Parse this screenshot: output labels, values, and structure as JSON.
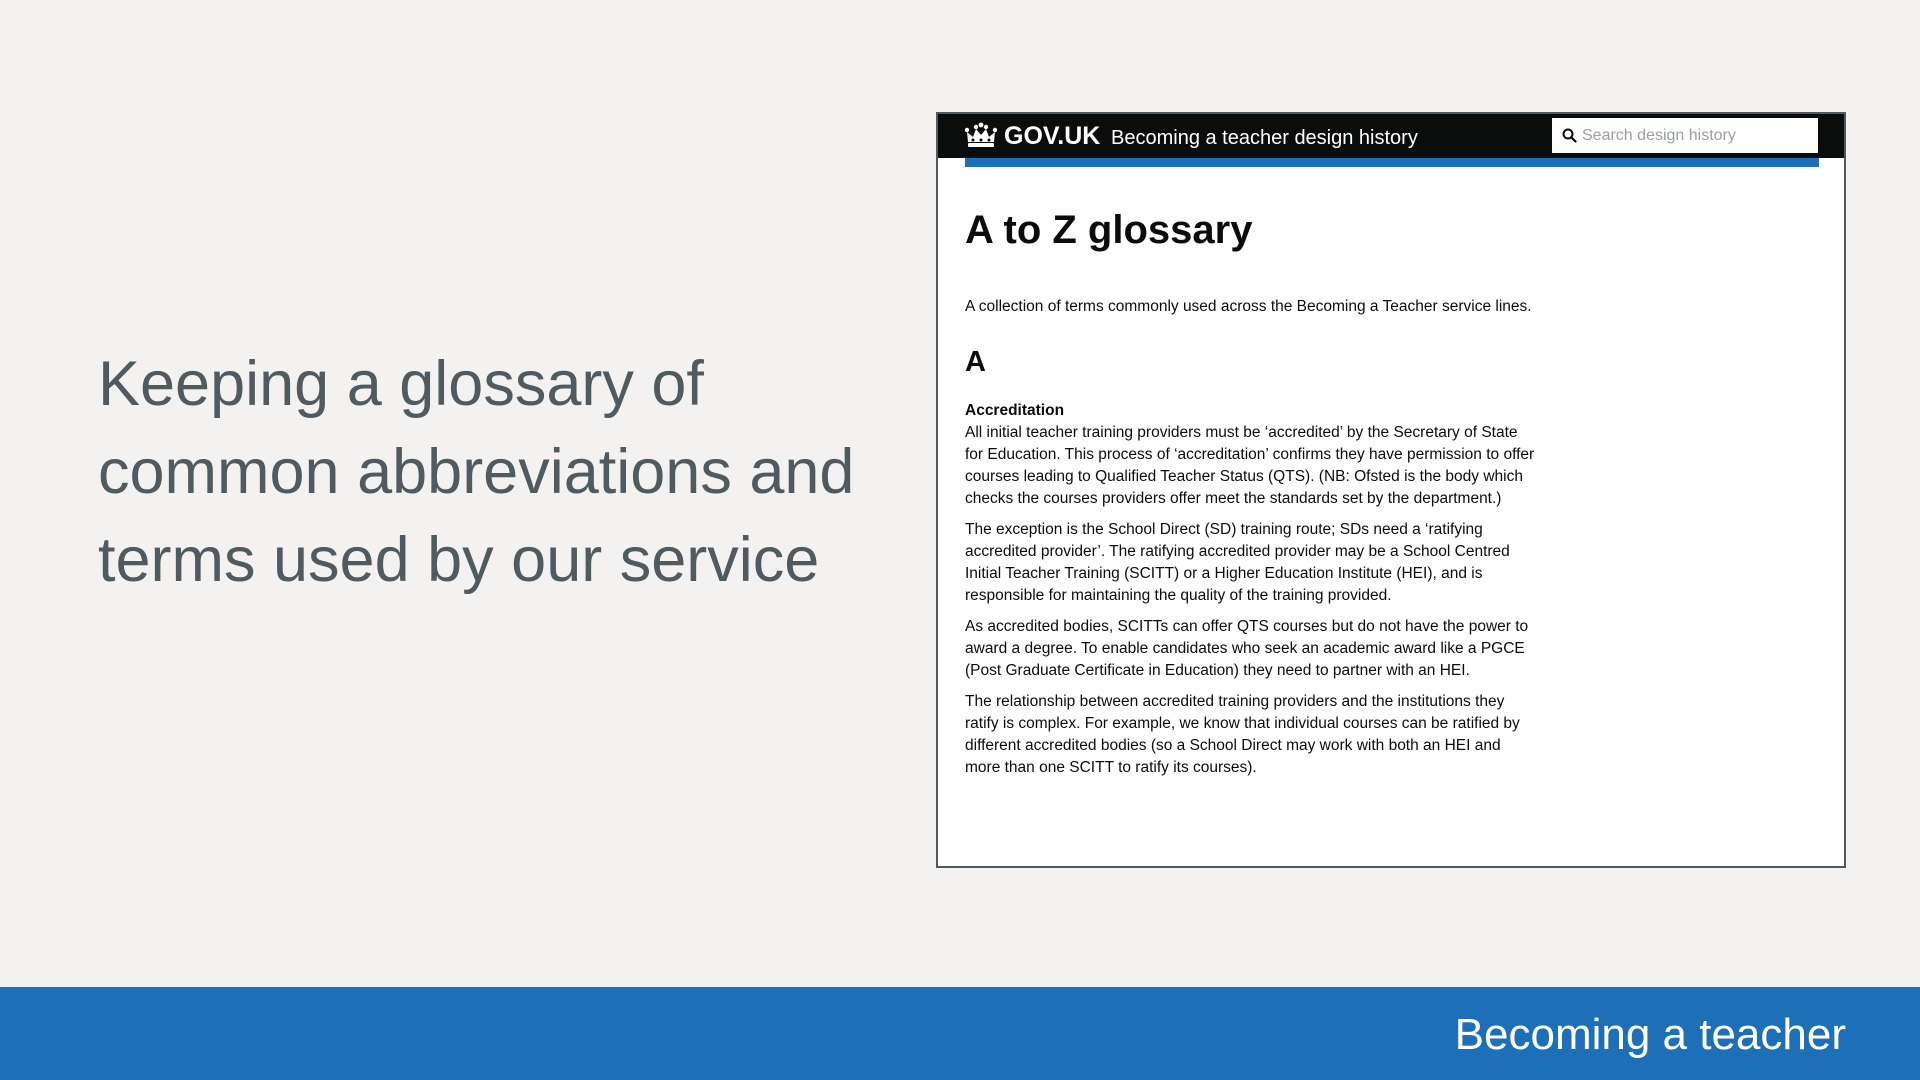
{
  "slide": {
    "headline": "Keeping a glossary of common abbreviations and terms used by our service",
    "footer_label": "Becoming a teacher",
    "footer_color": "#1d6fb8",
    "background_color": "#f3f2f1"
  },
  "screenshot": {
    "header": {
      "logo_icon": "crown-icon",
      "logotype": "GOV.UK",
      "service_name": "Becoming a teacher design history",
      "search_icon": "search-icon",
      "search_placeholder": "Search design history",
      "accent_color": "#1d70b8"
    },
    "page": {
      "title": "A to Z glossary",
      "intro": "A collection of terms commonly used across the Becoming a Teacher service lines.",
      "sections": [
        {
          "letter": "A",
          "terms": [
            {
              "term": "Accreditation",
              "paragraphs": [
                "All initial teacher training providers must be ‘accredited’ by the Secretary of State for Education. This process of ‘accreditation’ confirms they have permission to offer courses leading to Qualified Teacher Status (QTS). (NB: Ofsted is the body which checks the courses providers offer meet the standards set by the department.)",
                "The exception is the School Direct (SD) training route; SDs need a ‘ratifying accredited provider’. The ratifying accredited provider may be a School Centred Initial Teacher Training (SCITT) or a Higher Education Institute (HEI), and is responsible for maintaining the quality of the training provided.",
                "As accredited bodies, SCITTs can offer QTS courses but do not have the power to award a degree. To enable candidates who seek an academic award like a PGCE (Post Graduate Certificate in Education) they need to partner with an HEI.",
                "The relationship between accredited training providers and the institutions they ratify is complex. For example, we know that individual courses can be ratified by different accredited bodies (so a School Direct may work with both an HEI and more than one SCITT to ratify its courses)."
              ]
            }
          ]
        }
      ]
    }
  }
}
